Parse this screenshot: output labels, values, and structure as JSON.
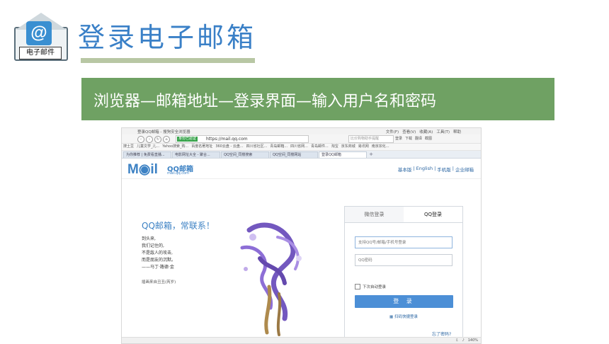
{
  "header": {
    "icon_label": "电子邮件",
    "icon_symbol": "@",
    "title": "登录电子邮箱",
    "banner": "浏览器—邮箱地址—登录界面—输入用户名和密码",
    "title_color": "#3a80c7",
    "banner_color": "#6fa163"
  },
  "browser": {
    "window_title": "登录QQ邮箱 - 搜狗安全浏览器",
    "menu": [
      "文件(F)",
      "查看(V)",
      "收藏(A)",
      "工具(T)",
      "帮助"
    ],
    "secure_label": "身份已验证",
    "url": "https://mail.qq.com",
    "search_placeholder": "比价购物助手提醒",
    "toolbar_right": [
      "登录",
      "下载",
      "翻译",
      "截图"
    ],
    "bookmarks": [
      "搜土豆",
      "儿童文学_儿...",
      "Yahoo搜索_购...",
      "百度名著地址",
      "360云盘 - 云盘...",
      "四川省社区...",
      "青岛邮箱...",
      "四川省网...",
      "青岛邮件...",
      "淘宝",
      "京东商城",
      "易讯网",
      "南京宗化..."
    ],
    "tabs": [
      {
        "label": "为你推荐 | 免费看直播...",
        "active": false
      },
      {
        "label": "电影网址大全 - 聚合...",
        "active": false
      },
      {
        "label": "QQ空间_同楼搜索",
        "active": false
      },
      {
        "label": "QQ空间_同楼网站",
        "active": false
      },
      {
        "label": "登录QQ邮箱",
        "active": true
      }
    ],
    "zoom": "140%"
  },
  "qqmail": {
    "logo_text": "M◉il",
    "logo_cn": "QQ邮箱",
    "logo_domain": "mail.qq.com",
    "top_links": [
      "基本版",
      "|",
      "English",
      "|",
      "手机版",
      "|",
      "企业邮箱"
    ],
    "slogan": "QQ邮箱，常联系！",
    "poem_lines": [
      "到头来,",
      "我们记住的,",
      "不是敌人的攻击,",
      "而是朋友的沉默。",
      "——马丁·路德·金"
    ],
    "credit": "插画来自丑丑(芮岁)",
    "login": {
      "tab_wechat": "微信登录",
      "tab_qq": "QQ登录",
      "account_placeholder": "支持QQ号/邮箱/手机号登录",
      "password_placeholder": "QQ密码",
      "auto_login": "下次自动登录",
      "login_button": "登 录",
      "qr_login": "扫码快捷登录"
    },
    "forgot_password": "忘了密码?"
  }
}
